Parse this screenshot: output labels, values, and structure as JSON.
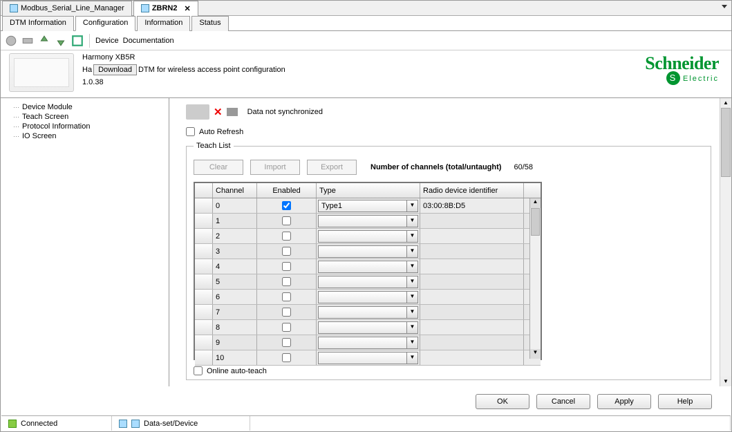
{
  "tabs": [
    {
      "label": "Modbus_Serial_Line_Manager",
      "active": false
    },
    {
      "label": "ZBRN2",
      "active": true
    }
  ],
  "subtabs": {
    "items": [
      "DTM Information",
      "Configuration",
      "Information",
      "Status"
    ],
    "active": "Configuration"
  },
  "toolbar": {
    "device_label": "Device",
    "doc_label": "Documentation"
  },
  "device": {
    "name": "Harmony XB5R",
    "desc_prefix": "Ha",
    "download_label": "Download",
    "desc_suffix": "DTM for wireless access point configuration",
    "version": "1.0.38"
  },
  "brand": {
    "name": "Schneider",
    "sub": "Electric"
  },
  "sidebar": {
    "items": [
      "Device Module",
      "Teach Screen",
      "Protocol Information",
      "IO Screen"
    ]
  },
  "main": {
    "sync_status": "Data not synchronized",
    "auto_refresh_label": "Auto Refresh",
    "teach_list_label": "Teach List",
    "buttons": {
      "clear": "Clear",
      "import": "Import",
      "export": "Export"
    },
    "num_channels_label": "Number of channels (total/untaught)",
    "num_channels_value": "60/58",
    "columns": {
      "channel": "Channel",
      "enabled": "Enabled",
      "type": "Type",
      "rdid": "Radio device identifier"
    },
    "rows": [
      {
        "channel": "0",
        "enabled": true,
        "type": "Type1",
        "rdid": "03:00:8B:D5"
      },
      {
        "channel": "1",
        "enabled": false,
        "type": "",
        "rdid": ""
      },
      {
        "channel": "2",
        "enabled": false,
        "type": "",
        "rdid": ""
      },
      {
        "channel": "3",
        "enabled": false,
        "type": "",
        "rdid": ""
      },
      {
        "channel": "4",
        "enabled": false,
        "type": "",
        "rdid": ""
      },
      {
        "channel": "5",
        "enabled": false,
        "type": "",
        "rdid": ""
      },
      {
        "channel": "6",
        "enabled": false,
        "type": "",
        "rdid": ""
      },
      {
        "channel": "7",
        "enabled": false,
        "type": "",
        "rdid": ""
      },
      {
        "channel": "8",
        "enabled": false,
        "type": "",
        "rdid": ""
      },
      {
        "channel": "9",
        "enabled": false,
        "type": "",
        "rdid": ""
      },
      {
        "channel": "10",
        "enabled": false,
        "type": "",
        "rdid": ""
      }
    ],
    "online_autoteach_label": "Online auto-teach"
  },
  "dialog_buttons": {
    "ok": "OK",
    "cancel": "Cancel",
    "apply": "Apply",
    "help": "Help"
  },
  "statusbar": {
    "connected": "Connected",
    "dataset": "Data-set/Device"
  }
}
